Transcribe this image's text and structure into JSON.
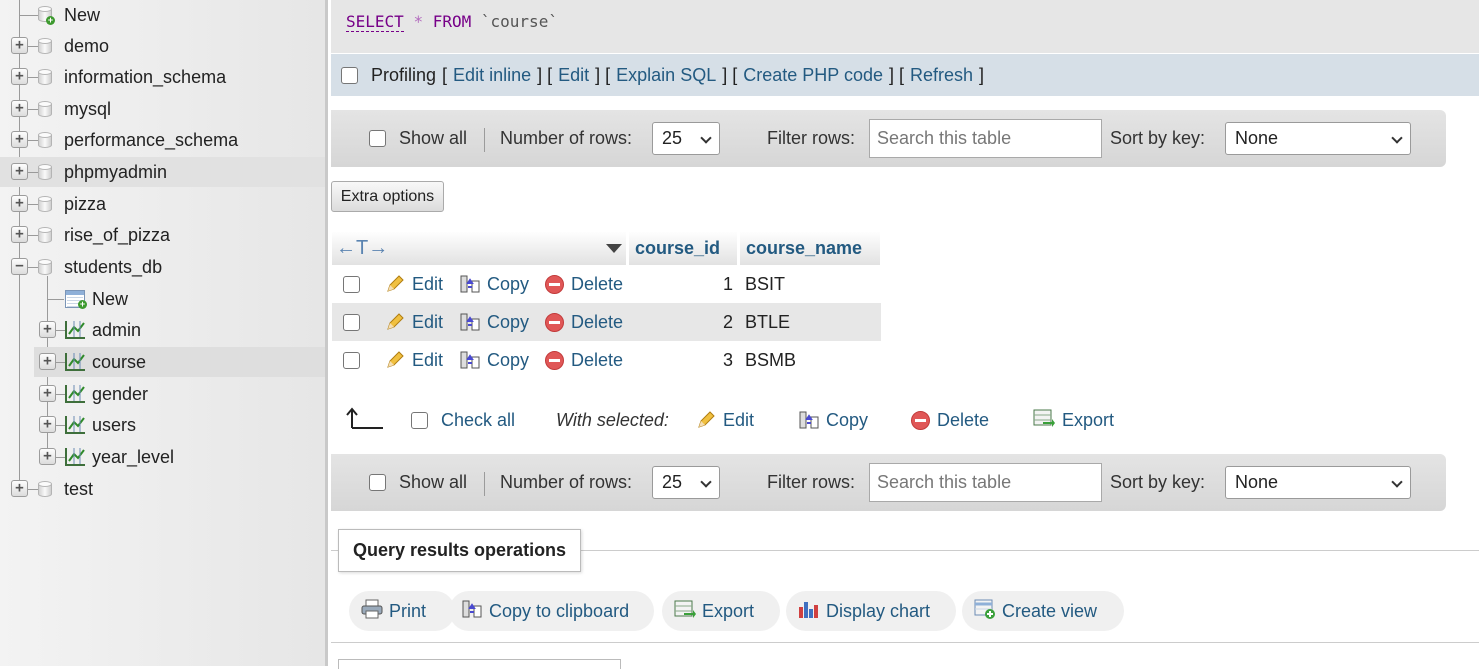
{
  "nav_tree": {
    "top_new": "New",
    "databases": [
      "demo",
      "information_schema",
      "mysql",
      "performance_schema",
      "phpmyadmin",
      "pizza",
      "rise_of_pizza",
      "students_db"
    ],
    "students_db_children": {
      "new": "New",
      "tables": [
        "admin",
        "course",
        "gender",
        "users",
        "year_level"
      ]
    },
    "last_db": "test"
  },
  "sql": {
    "select": "SELECT",
    "star": "*",
    "from": "FROM",
    "table": "`course`"
  },
  "profiling": {
    "label": "Profiling",
    "links": [
      "Edit inline",
      "Edit",
      "Explain SQL",
      "Create PHP code",
      "Refresh"
    ]
  },
  "navbar": {
    "show_all": "Show all",
    "rows_label": "Number of rows:",
    "rows_value": "25",
    "filter_label": "Filter rows:",
    "filter_placeholder": "Search this table",
    "sort_label": "Sort by key:",
    "sort_value": "None"
  },
  "extra_options": "Extra options",
  "table": {
    "arrows": "←T→",
    "columns": [
      "course_id",
      "course_name"
    ],
    "actions": {
      "edit": "Edit",
      "copy": "Copy",
      "delete": "Delete"
    },
    "rows": [
      {
        "course_id": "1",
        "course_name": "BSIT"
      },
      {
        "course_id": "2",
        "course_name": "BTLE"
      },
      {
        "course_id": "3",
        "course_name": "BSMB"
      }
    ]
  },
  "with_selected": {
    "check_all": "Check all",
    "label": "With selected:",
    "edit": "Edit",
    "copy": "Copy",
    "delete": "Delete",
    "export": "Export"
  },
  "query_results_operations": {
    "title": "Query results operations",
    "buttons": [
      "Print",
      "Copy to clipboard",
      "Export",
      "Display chart",
      "Create view"
    ]
  }
}
